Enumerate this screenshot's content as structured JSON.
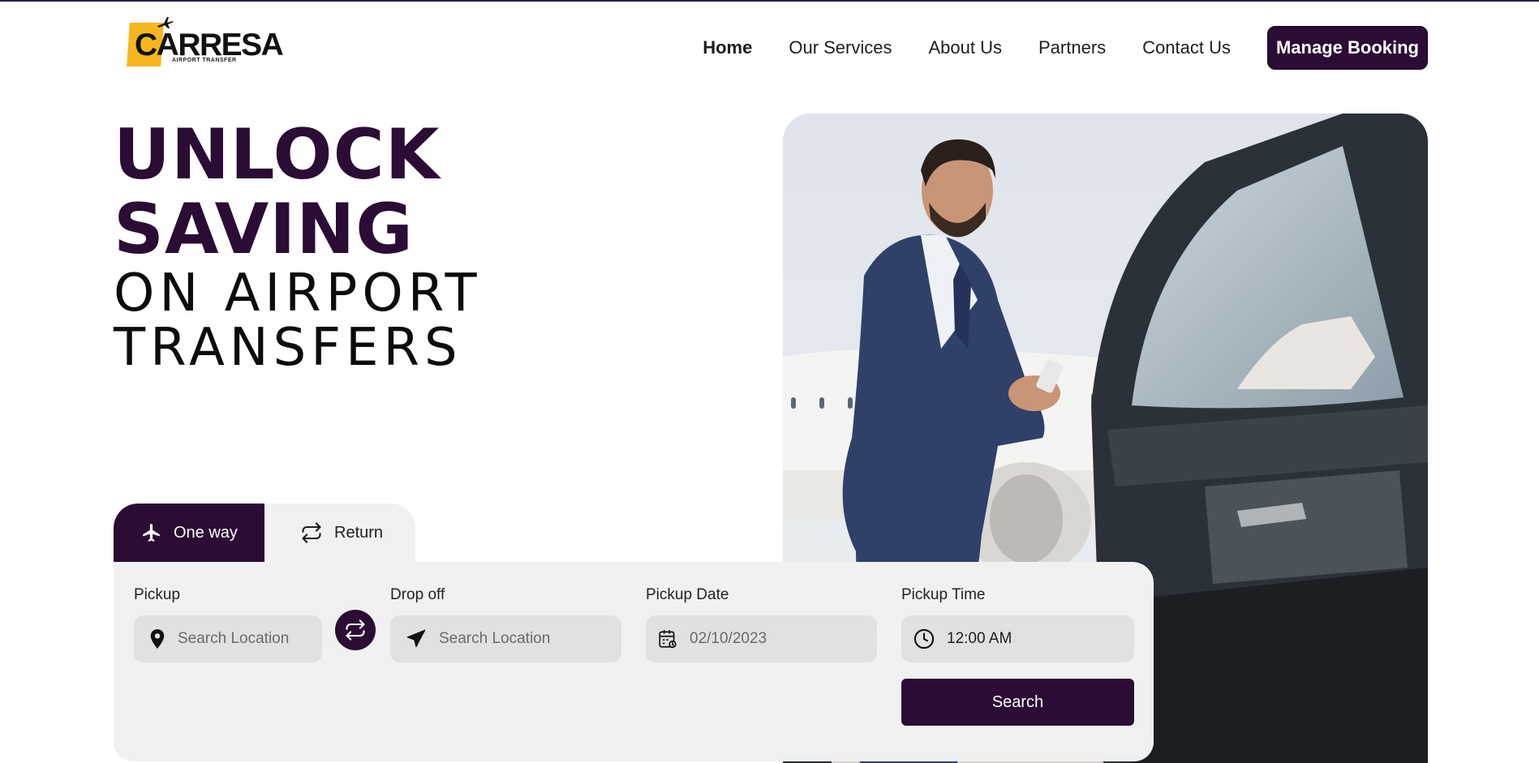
{
  "brand": {
    "name": "CARRESA",
    "tagline": "AIRPORT TRANSFER",
    "logo_color": "#f5b71d"
  },
  "nav": {
    "items": [
      {
        "label": "Home",
        "active": true
      },
      {
        "label": "Our Services",
        "active": false
      },
      {
        "label": "About Us",
        "active": false
      },
      {
        "label": "Partners",
        "active": false
      },
      {
        "label": "Contact Us",
        "active": false
      }
    ],
    "cta": "Manage Booking"
  },
  "hero": {
    "line1": "UNLOCK",
    "line2": "SAVING",
    "line3": "ON AIRPORT",
    "line4": "TRANSFERS"
  },
  "booking": {
    "tabs": [
      {
        "label": "One way",
        "icon": "airplane-icon",
        "selected": true
      },
      {
        "label": "Return",
        "icon": "repeat-icon",
        "selected": false
      }
    ],
    "pickup": {
      "label": "Pickup",
      "placeholder": "Search Location",
      "icon": "map-pin-icon"
    },
    "dropoff": {
      "label": "Drop off",
      "placeholder": "Search Location",
      "icon": "paper-plane-icon"
    },
    "date": {
      "label": "Pickup Date",
      "value": "02/10/2023",
      "icon": "calendar-icon"
    },
    "time": {
      "label": "Pickup Time",
      "value": "12:00 AM",
      "icon": "clock-icon"
    },
    "search_label": "Search"
  },
  "colors": {
    "primary": "#2b0c34",
    "panel": "#f1f1f1",
    "field": "#e1e1e1"
  }
}
